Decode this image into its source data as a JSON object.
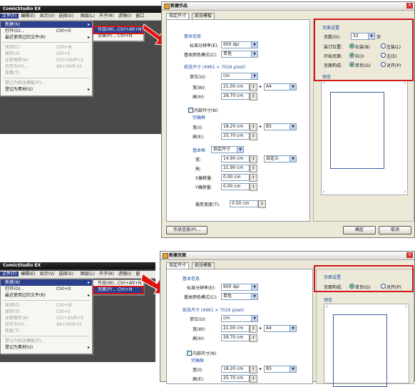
{
  "top": {
    "app": {
      "title": "ComicStudio EX",
      "menus": [
        "文件(F)",
        "编辑(E)",
        "显示(V)",
        "选择(S)",
        "图层(L)",
        "尺子(R)",
        "滤镜(I)",
        "窗口"
      ],
      "file_menu": [
        {
          "label": "新建(N)",
          "shortcut": "",
          "state": "highlight",
          "arrow": true
        },
        {
          "label": "打开(O)...",
          "shortcut": "Ctrl+O",
          "state": "normal"
        },
        {
          "label": "最近使用过的文件(R)",
          "shortcut": "",
          "state": "normal",
          "arrow": true
        },
        {
          "label": "关闭(C)",
          "shortcut": "Ctrl+W",
          "state": "disabled"
        },
        {
          "label": "保存(S)",
          "shortcut": "Ctrl+S",
          "state": "disabled"
        },
        {
          "label": "全部保存(A)",
          "shortcut": "Ctrl+Shift+S",
          "state": "disabled"
        },
        {
          "label": "另存为(V)...",
          "shortcut": "Alt+Shift+S",
          "state": "disabled"
        },
        {
          "label": "恢复(T)",
          "shortcut": "",
          "state": "disabled"
        },
        {
          "label": "登记为纸张模板(P)...",
          "shortcut": "",
          "state": "disabled"
        },
        {
          "label": "登记为素材(U)",
          "shortcut": "",
          "state": "normal",
          "arrow": true
        }
      ],
      "new_submenu": [
        {
          "label": "作品(W)...",
          "shortcut": "Ctrl+Alt+N",
          "highlight": true
        },
        {
          "label": "页面(P)...",
          "shortcut": "Ctrl+N",
          "highlight": false
        }
      ]
    },
    "dialog": {
      "title": "新建作品",
      "tabs": [
        "指定尺寸",
        "纸张模板"
      ],
      "basic_info": "基本信息",
      "resolution_label": "标准分辨率(E):",
      "resolution_value": "600 dpi",
      "color_mode_label": "基本颜色模式(C):",
      "color_mode_value": "单色",
      "paper_size_label": "纸张尺寸 (4961 × 7016 pixel)",
      "unit_label": "单位(U):",
      "unit_value": "cm",
      "width_label": "宽(W):",
      "width_value": "21.00 cm",
      "paper_preset": "A4",
      "height_label": "高(H):",
      "height_value": "29.70 cm",
      "inner_check_label": "内部尺寸(N)",
      "frame_label": "完稿框",
      "inner_width_label": "宽(I):",
      "inner_width_value": "18.20 cm",
      "inner_preset": "B5",
      "inner_height_label": "高(E):",
      "inner_height_value": "25.70 cm",
      "base_frame_label": "基本框",
      "base_frame_mode": "指定尺寸",
      "bf_width_label": "宽:",
      "bf_width_value": "14.90 cm",
      "bf_preset": "自定义",
      "bf_height_label": "高:",
      "bf_height_value": "21.90 cm",
      "x_offset_label": "X偏移量:",
      "x_offset_value": "0.00 cm",
      "y_offset_label": "Y偏移量:",
      "y_offset_value": "0.00 cm",
      "bleed_label": "裁剪宽度(T):",
      "bleed_value": "0.50 cm",
      "page_settings": "页面设置",
      "pages_label": "页数(G):",
      "pages_value": "32",
      "pages_unit": "页",
      "binding_label": "装订位置:",
      "binding_right": "右装(B)",
      "binding_left": "左装(L)",
      "start_label": "开始页面:",
      "start_right": "右(I)",
      "start_left": "左(E)",
      "compose_label": "页面构成:",
      "compose_single": "单页(G)",
      "compose_spread": "对开(P)",
      "preview": "预览",
      "info_button": "作品信息(P)...",
      "ok_button": "确定",
      "cancel_button": "取消"
    }
  },
  "bottom": {
    "app": {
      "title": "ComicStudio EX",
      "menus": [
        "文件(F)",
        "编辑(E)",
        "显示(V)",
        "选择(S)",
        "图层(L)",
        "尺子(R)",
        "滤镜(I)",
        "窗"
      ],
      "file_menu": [
        {
          "label": "新建(N)",
          "shortcut": "",
          "state": "highlight",
          "arrow": true
        },
        {
          "label": "打开(O)...",
          "shortcut": "Ctrl+O",
          "state": "normal"
        },
        {
          "label": "最近使用过的文件(R)",
          "shortcut": "",
          "state": "normal",
          "arrow": true
        },
        {
          "label": "关闭(C)",
          "shortcut": "Ctrl+W",
          "state": "disabled"
        },
        {
          "label": "保存(S)",
          "shortcut": "Ctrl+S",
          "state": "disabled"
        },
        {
          "label": "全部保存(A)",
          "shortcut": "Ctrl+Shift+S",
          "state": "disabled"
        },
        {
          "label": "另存为(V)...",
          "shortcut": "Alt+Shift+S",
          "state": "disabled"
        },
        {
          "label": "恢复(T)",
          "shortcut": "",
          "state": "disabled"
        },
        {
          "label": "登记为纸张模板(P)...",
          "shortcut": "",
          "state": "disabled"
        },
        {
          "label": "登记为素材(U)",
          "shortcut": "",
          "state": "normal",
          "arrow": true
        }
      ],
      "new_submenu": [
        {
          "label": "作品(W)...",
          "shortcut": "Ctrl+Alt+N",
          "highlight": false
        },
        {
          "label": "页面(P)...",
          "shortcut": "Ctrl+N",
          "highlight": true
        }
      ]
    },
    "dialog": {
      "title": "新建页面",
      "tabs": [
        "指定尺寸",
        "纸张模板"
      ],
      "basic_info": "基本信息",
      "resolution_label": "标准分辨率(E):",
      "resolution_value": "600 dpi",
      "color_mode_label": "基本颜色模式(C):",
      "color_mode_value": "单色",
      "paper_size_label": "纸张尺寸 (4961 × 7016 pixel)",
      "unit_label": "单位(U):",
      "unit_value": "cm",
      "width_label": "宽(W):",
      "width_value": "21.00 cm",
      "paper_preset": "A4",
      "height_label": "高(H):",
      "height_value": "29.70 cm",
      "inner_check_label": "内部尺寸(N)",
      "frame_label": "完稿框",
      "inner_width_label": "宽(I):",
      "inner_width_value": "18.20 cm",
      "inner_preset": "B5",
      "inner_height_label": "高(E):",
      "inner_height_value": "25.70 cm",
      "page_settings": "页面设置",
      "compose_label": "页面构成:",
      "compose_single": "单页(G)",
      "compose_spread": "对开(P)",
      "preview": "预览"
    }
  },
  "colors": {
    "highlight": "#d01818",
    "arrow": "#e01010"
  }
}
